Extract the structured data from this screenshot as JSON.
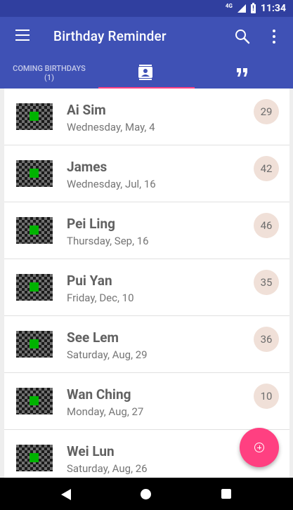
{
  "status_bar": {
    "network": "4G",
    "time": "11:34"
  },
  "toolbar": {
    "title": "Birthday Reminder"
  },
  "tabs": {
    "coming_label": "COMING BIRTHDAYS",
    "coming_count": "(1)"
  },
  "contacts": [
    {
      "name": "Ai Sim",
      "date": "Wednesday, May,  4",
      "age": "29"
    },
    {
      "name": "James",
      "date": "Wednesday, Jul,  16",
      "age": "42"
    },
    {
      "name": "Pei Ling",
      "date": "Thursday, Sep,  16",
      "age": "46"
    },
    {
      "name": "Pui Yan",
      "date": "Friday, Dec,  10",
      "age": "35"
    },
    {
      "name": "See Lem",
      "date": "Saturday, Aug,  29",
      "age": "36"
    },
    {
      "name": "Wan Ching",
      "date": "Monday, Aug,  27",
      "age": "10"
    },
    {
      "name": "Wei Lun",
      "date": "Saturday, Aug,  26",
      "age": ""
    }
  ]
}
